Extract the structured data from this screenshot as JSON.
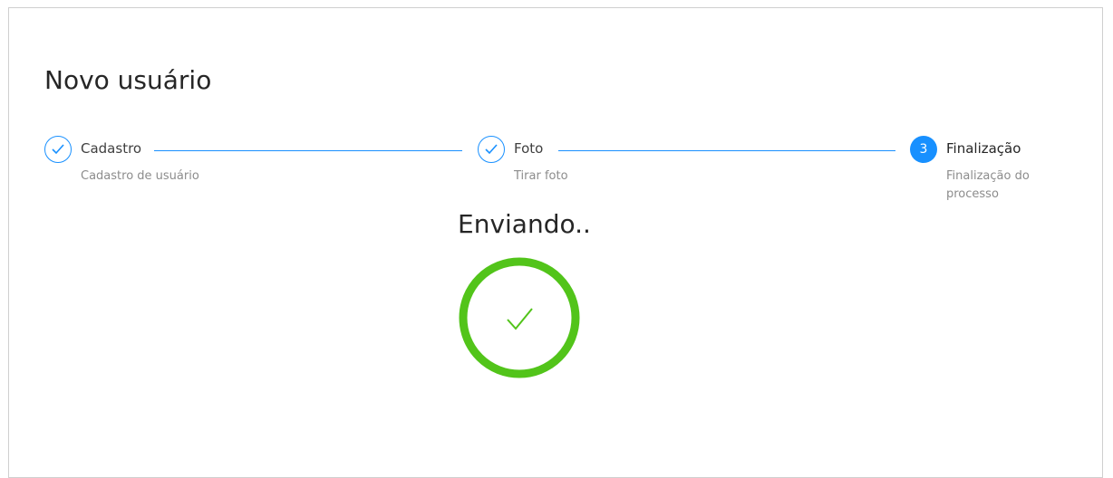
{
  "page": {
    "title": "Novo usuário",
    "status": "Enviando.."
  },
  "steps": [
    {
      "title": "Cadastro",
      "description": "Cadastro de usuário",
      "state": "finished"
    },
    {
      "title": "Foto",
      "description": "Tirar foto",
      "state": "finished"
    },
    {
      "title": "Finalização",
      "description": "Finalização do processo",
      "state": "active",
      "number": "3"
    }
  ],
  "colors": {
    "accent": "#1890ff",
    "success": "#52c41a"
  },
  "icons": {
    "step_done": "check-icon",
    "result": "success-check-icon"
  }
}
